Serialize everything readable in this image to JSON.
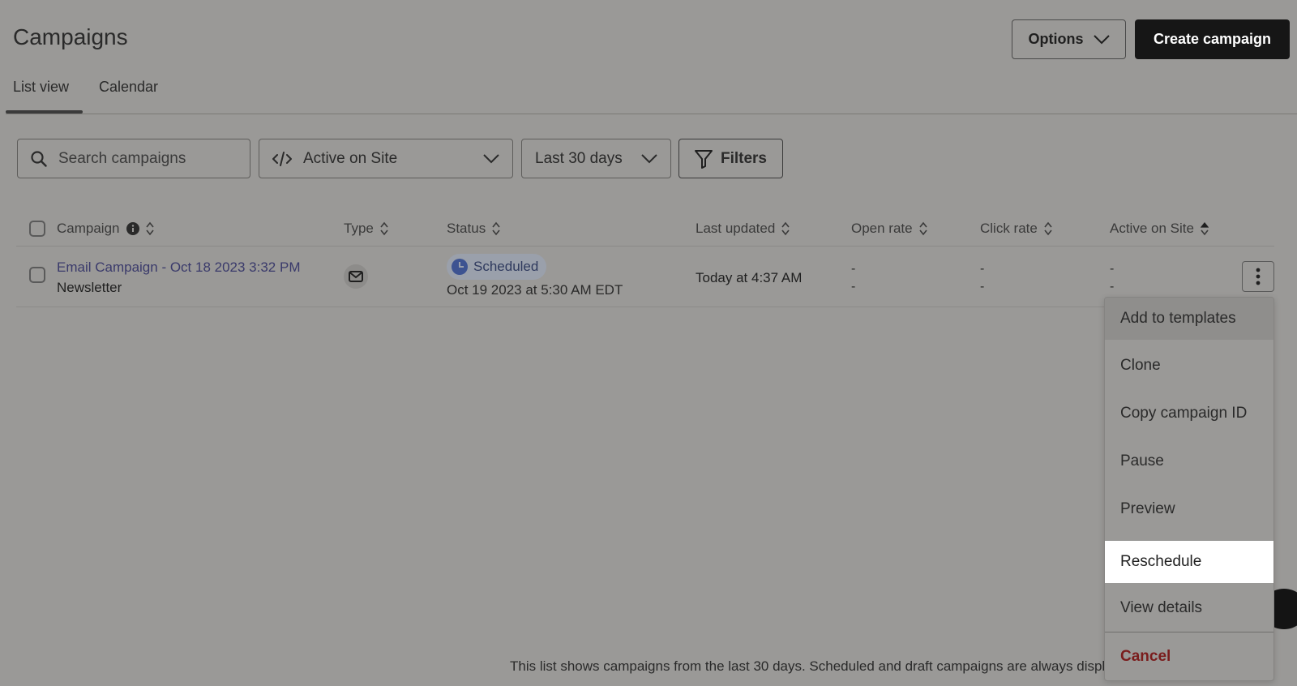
{
  "header": {
    "title": "Campaigns",
    "options_label": "Options",
    "create_label": "Create campaign"
  },
  "tabs": [
    {
      "label": "List view",
      "active": true
    },
    {
      "label": "Calendar",
      "active": false
    }
  ],
  "filters": {
    "search_placeholder": "Search campaigns",
    "view_select": "Active on Site",
    "date_range": "Last 30 days",
    "filters_label": "Filters"
  },
  "table": {
    "columns": [
      "Campaign",
      "Type",
      "Status",
      "Last updated",
      "Open rate",
      "Click rate",
      "Active on Site"
    ],
    "rows": [
      {
        "name": "Email Campaign - Oct 18 2023 3:32 PM",
        "subtitle": "Newsletter",
        "type_icon": "envelope-icon",
        "status": "Scheduled",
        "status_date": "Oct 19 2023 at 5:30 AM EDT",
        "last_updated": "Today at 4:37 AM",
        "open_rate": [
          "-",
          "-"
        ],
        "click_rate": [
          "-",
          "-"
        ],
        "active_on_site": [
          "-",
          "-"
        ]
      }
    ]
  },
  "menu": {
    "items": [
      "Add to templates",
      "Clone",
      "Copy campaign ID",
      "Pause",
      "Preview",
      "Reschedule",
      "View details"
    ],
    "highlighted": "Reschedule",
    "danger_item": "Cancel"
  },
  "footer": {
    "note": "This list shows campaigns from the last 30 days. Scheduled and draft campaigns are always displa"
  },
  "colors": {
    "overlay_bg": "#9a9997",
    "primary_button": "#161616",
    "link": "#3a3a6b",
    "danger": "#7a1d1d",
    "highlight": "#ffffff"
  }
}
